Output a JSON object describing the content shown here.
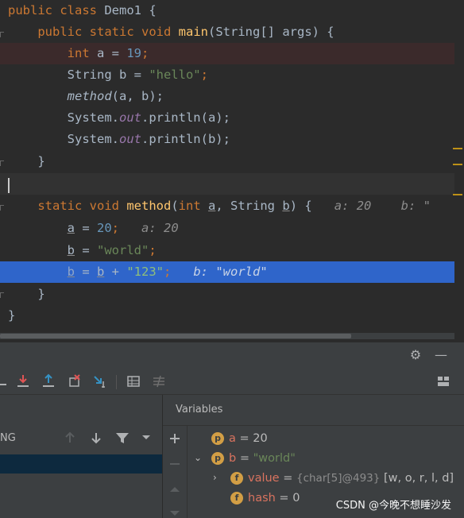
{
  "editor": {
    "lines": {
      "l1": {
        "kw1": "public",
        "sp1": " ",
        "kw2": "class",
        "name": " Demo1 {"
      },
      "l2": {
        "indent": "    ",
        "kw1": "public",
        "kw2": " static",
        "kw3": " void",
        "fn": " main",
        "rest": "(String[] args) {"
      },
      "l3": {
        "indent": "        ",
        "kw": "int",
        "mid": " a = ",
        "num": "19",
        "end": ";"
      },
      "l4": {
        "indent": "        ",
        "mid": "String b = ",
        "str": "\"hello\"",
        "end": ";"
      },
      "l5": {
        "indent": "        ",
        "call": "method",
        "rest": "(a, b);"
      },
      "l6": {
        "indent": "        ",
        "obj": "System.",
        "fld": "out",
        "rest": ".println(a);"
      },
      "l7": {
        "indent": "        ",
        "obj": "System.",
        "fld": "out",
        "rest": ".println(b);"
      },
      "l8": {
        "text": "    }"
      },
      "l10": {
        "indent": "    ",
        "kw1": "static",
        "kw2": " void",
        "fn": " method",
        "p1": "(",
        "kw3": "int",
        "p2": " ",
        "a": "a",
        "p3": ", String ",
        "b": "b",
        "p4": ") {",
        "hint1": "   a: 20",
        "hint2": "    b: \""
      },
      "l11": {
        "indent": "        ",
        "var": "a",
        "mid": " = ",
        "num": "20",
        "end": ";",
        "hint": "   a: 20"
      },
      "l12": {
        "indent": "        ",
        "var": "b",
        "mid": " = ",
        "str": "\"world\"",
        "end": ";"
      },
      "l13": {
        "indent": "        ",
        "var": "b",
        "mid": " = ",
        "var2": "b",
        "plus": " + ",
        "str": "\"123\"",
        "end": ";",
        "hint": "   b: \"world\""
      },
      "l14": {
        "text": "    }"
      },
      "l15": {
        "text": "}"
      }
    }
  },
  "debugger": {
    "variables_title": "Variables",
    "thread_label": "NG",
    "vars": [
      {
        "badge": "p",
        "name": "a",
        "eq": " = ",
        "value": "20"
      },
      {
        "badge": "p",
        "name": "b",
        "eq": " = ",
        "value": "\"world\""
      },
      {
        "badge": "f",
        "name": "value",
        "eq": " = ",
        "type": "{char[5]@493}",
        "value": " [w, o, r, l, d]"
      },
      {
        "badge": "f",
        "name": "hash",
        "eq": " = ",
        "value": "0"
      }
    ]
  },
  "watermark": "CSDN @今晚不想睡沙发",
  "colors": {
    "keyword": "#cc7832",
    "function": "#ffc66d",
    "number": "#6897bb",
    "string": "#6a8759",
    "field": "#9876aa",
    "exec_line": "#2f65ca",
    "breakpoint_line": "#3b2a2b"
  }
}
